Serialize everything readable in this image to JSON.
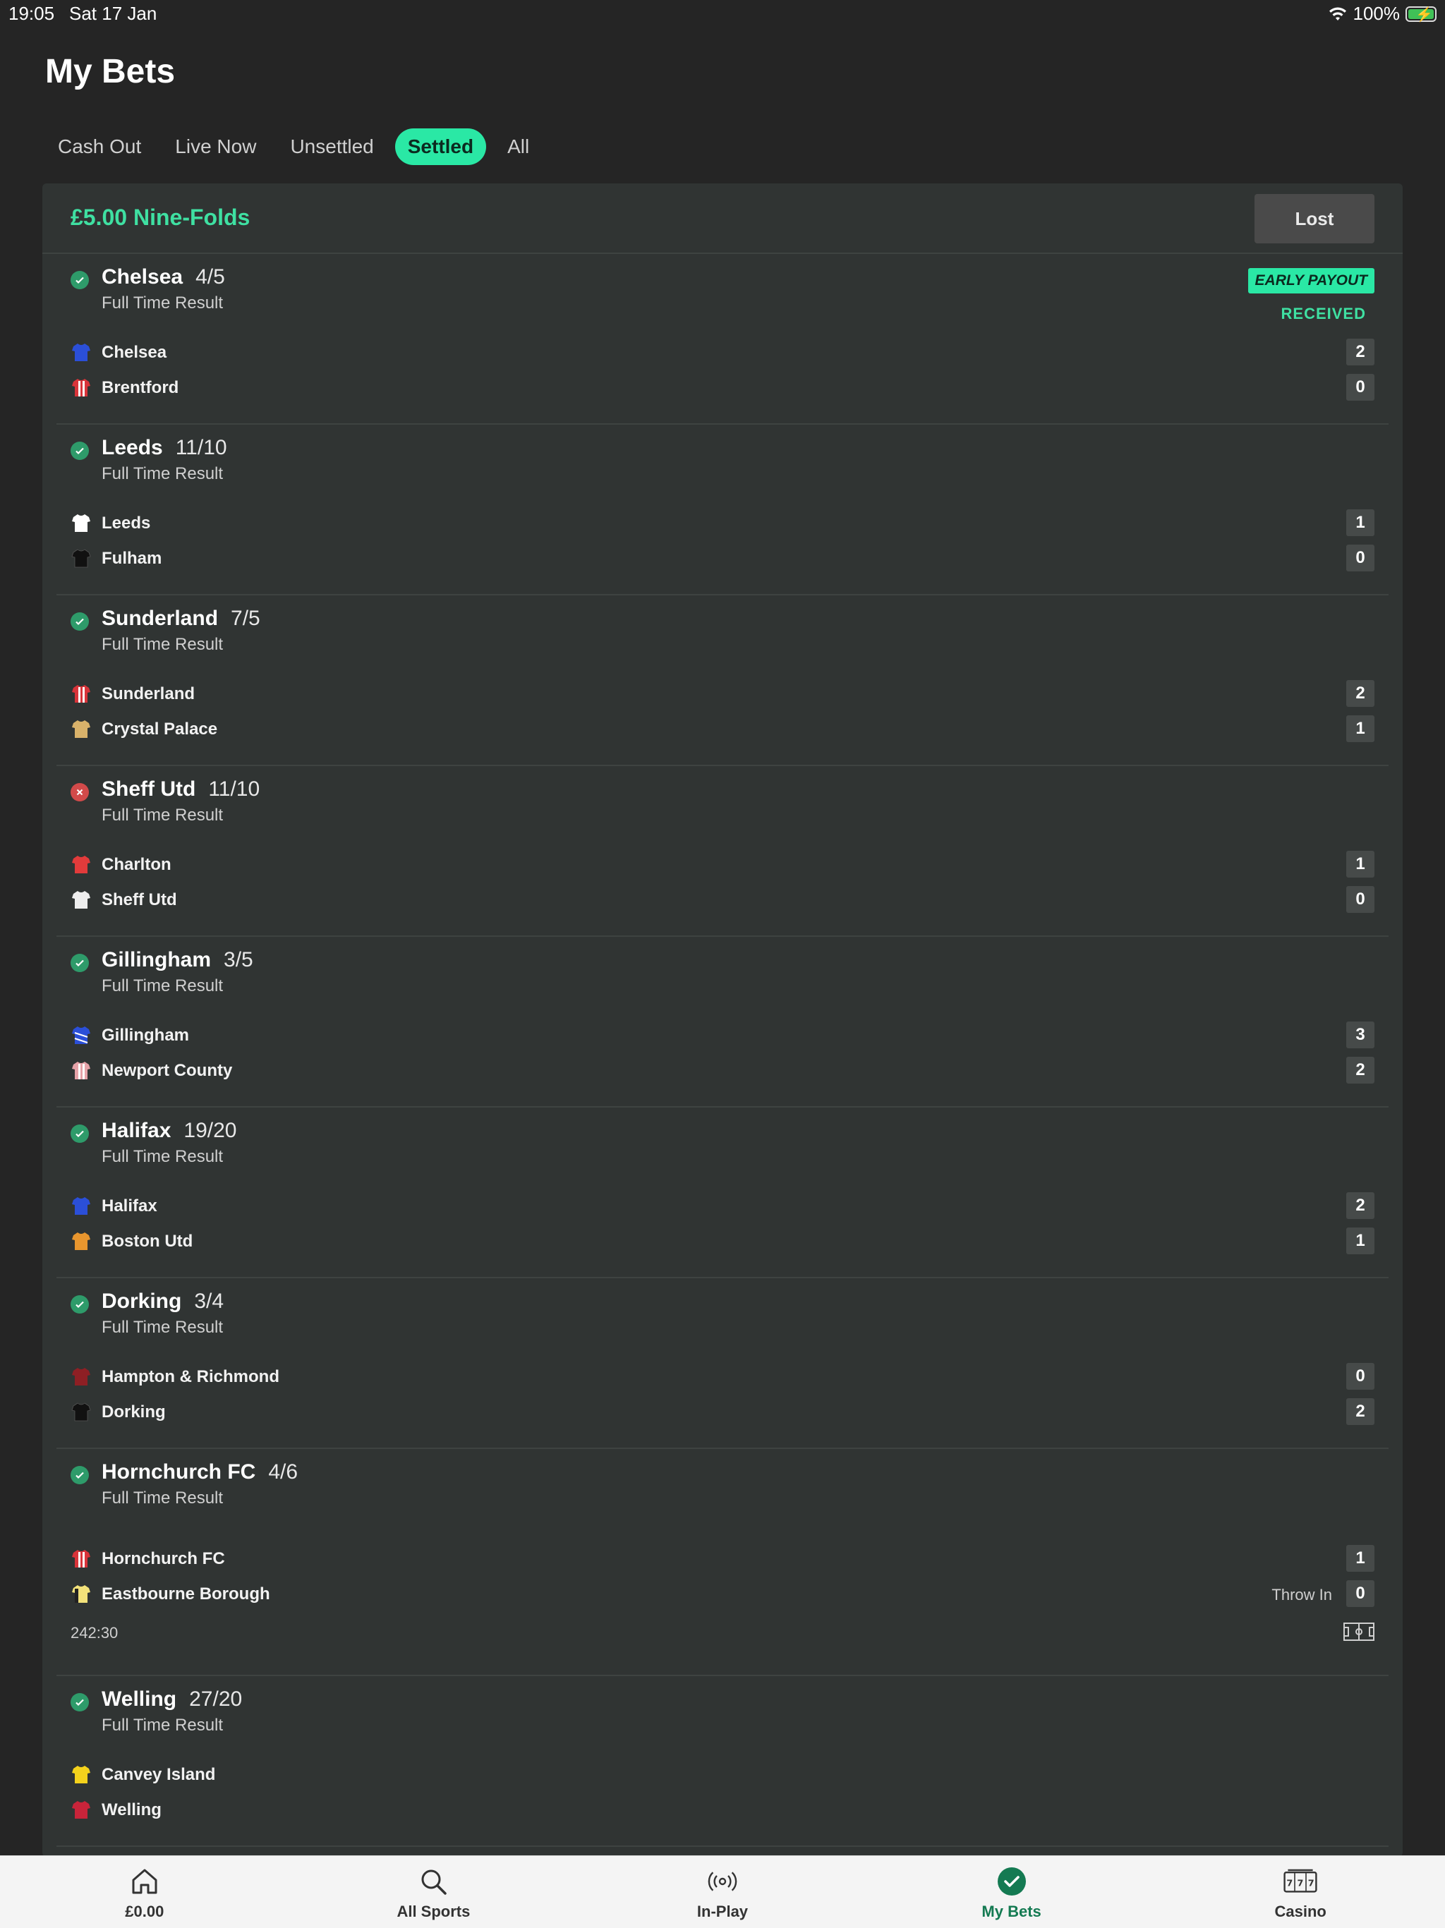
{
  "status_bar": {
    "time": "19:05",
    "date": "Sat 17 Jan",
    "battery": "100%"
  },
  "page_title": "My Bets",
  "tabs": [
    {
      "label": "Cash Out"
    },
    {
      "label": "Live Now"
    },
    {
      "label": "Unsettled"
    },
    {
      "label": "Settled",
      "active": true
    },
    {
      "label": "All"
    }
  ],
  "bet": {
    "title": "£5.00 Nine-Folds",
    "status": "Lost",
    "early_payout_badge": "EARLY PAYOUT",
    "early_payout_status": "RECEIVED",
    "selections": [
      {
        "name": "Chelsea",
        "odds": "4/5",
        "market": "Full Time Result",
        "result": "won",
        "teams": [
          {
            "name": "Chelsea",
            "score": "2",
            "kit": "#2b4fd8"
          },
          {
            "name": "Brentford",
            "score": "0",
            "kit": "#d8343a"
          }
        ]
      },
      {
        "name": "Leeds",
        "odds": "11/10",
        "market": "Full Time Result",
        "result": "won",
        "teams": [
          {
            "name": "Leeds",
            "score": "1",
            "kit": "#ffffff"
          },
          {
            "name": "Fulham",
            "score": "0",
            "kit": "#111111"
          }
        ]
      },
      {
        "name": "Sunderland",
        "odds": "7/5",
        "market": "Full Time Result",
        "result": "won",
        "teams": [
          {
            "name": "Sunderland",
            "score": "2",
            "kit": "#d8343a"
          },
          {
            "name": "Crystal Palace",
            "score": "1",
            "kit": "#d9b26a"
          }
        ]
      },
      {
        "name": "Sheff Utd",
        "odds": "11/10",
        "market": "Full Time Result",
        "result": "lost",
        "teams": [
          {
            "name": "Charlton",
            "score": "1",
            "kit": "#e23b3b"
          },
          {
            "name": "Sheff Utd",
            "score": "0",
            "kit": "#eeeeee"
          }
        ]
      },
      {
        "name": "Gillingham",
        "odds": "3/5",
        "market": "Full Time Result",
        "result": "won",
        "teams": [
          {
            "name": "Gillingham",
            "score": "3",
            "kit": "#2b4fd8"
          },
          {
            "name": "Newport County",
            "score": "2",
            "kit": "#e6a2a8"
          }
        ]
      },
      {
        "name": "Halifax",
        "odds": "19/20",
        "market": "Full Time Result",
        "result": "won",
        "teams": [
          {
            "name": "Halifax",
            "score": "2",
            "kit": "#2b4fd8"
          },
          {
            "name": "Boston Utd",
            "score": "1",
            "kit": "#e8962e"
          }
        ]
      },
      {
        "name": "Dorking",
        "odds": "3/4",
        "market": "Full Time Result",
        "result": "won",
        "teams": [
          {
            "name": "Hampton & Richmond",
            "score": "0",
            "kit": "#8e1f24"
          },
          {
            "name": "Dorking",
            "score": "2",
            "kit": "#111111"
          }
        ]
      },
      {
        "name": "Hornchurch FC",
        "odds": "4/6",
        "market": "Full Time Result",
        "result": "won",
        "teams": [
          {
            "name": "Hornchurch FC",
            "score": "1",
            "kit": "#d8343a"
          },
          {
            "name": "Eastbourne Borough",
            "score": "0",
            "kit": "#f3e27a"
          }
        ],
        "live_event": "Throw In",
        "match_clock": "242:30"
      },
      {
        "name": "Welling",
        "odds": "27/20",
        "market": "Full Time Result",
        "result": "won",
        "teams": [
          {
            "name": "Canvey Island",
            "score": "",
            "kit": "#f4d21c"
          },
          {
            "name": "Welling",
            "score": "",
            "kit": "#c8243a"
          }
        ]
      }
    ]
  },
  "bottom_nav": [
    {
      "label": "£0.00",
      "icon": "home-icon"
    },
    {
      "label": "All Sports",
      "icon": "search-icon"
    },
    {
      "label": "In-Play",
      "icon": "live-icon"
    },
    {
      "label": "My Bets",
      "icon": "check-circle-icon",
      "active": true
    },
    {
      "label": "Casino",
      "icon": "slot-machine-icon"
    }
  ],
  "colors": {
    "accent": "#2ae8a5",
    "background": "#252525",
    "card": "#303433",
    "won": "#2e9b6a",
    "lost": "#d24a4a"
  }
}
